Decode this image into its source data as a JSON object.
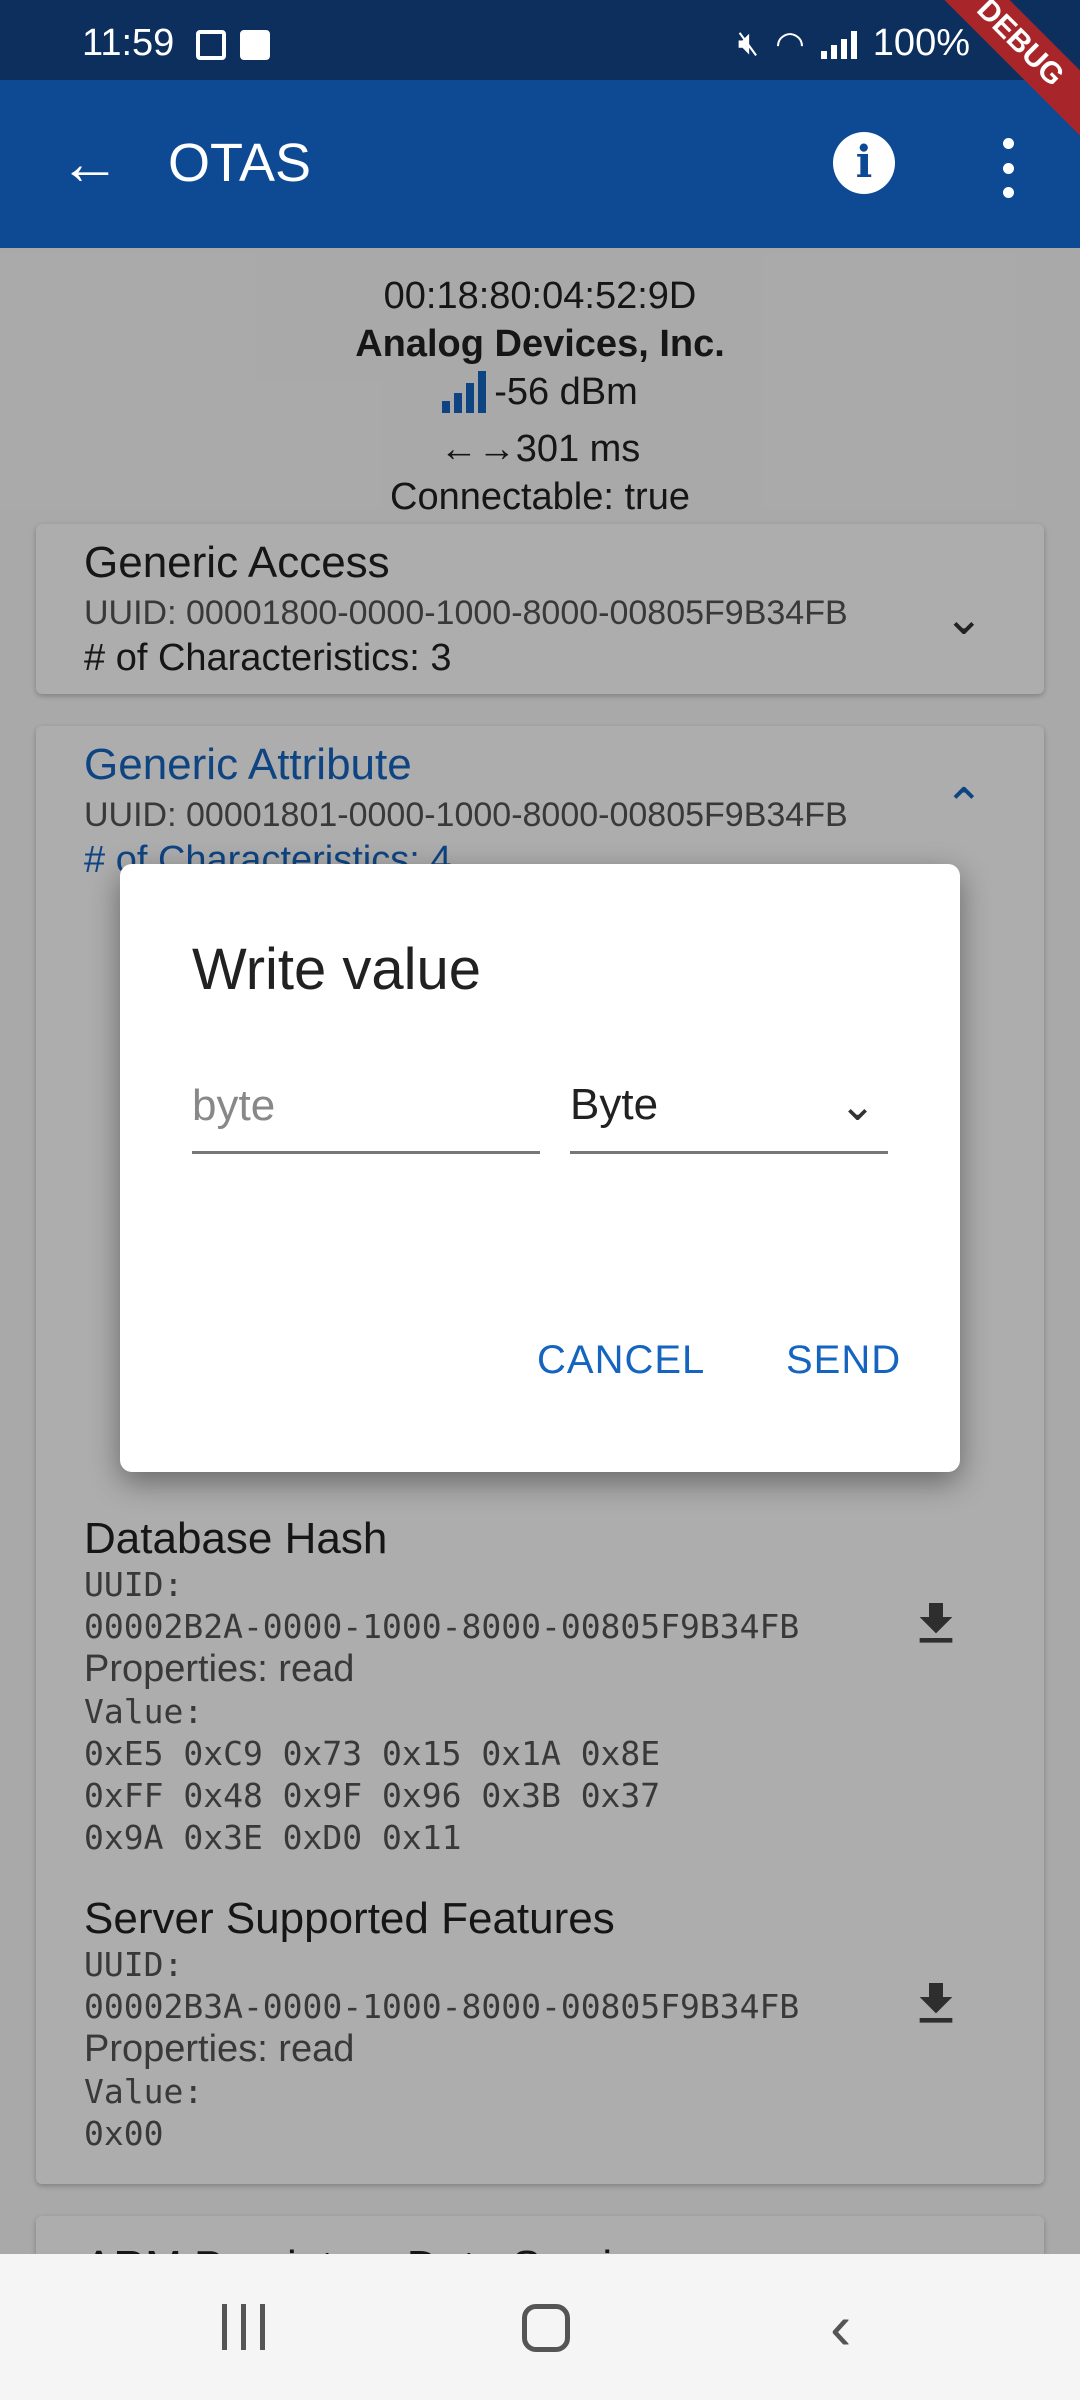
{
  "status_bar": {
    "time": "11:59",
    "battery": "100%",
    "icons": [
      "image-icon",
      "screen-record-icon",
      "mute-icon",
      "wifi-icon",
      "signal-icon",
      "battery-icon"
    ]
  },
  "app_bar": {
    "title": "OTAS",
    "debug_label": "DEBUG",
    "back_icon": "arrow-back-icon",
    "info_icon": "info-icon",
    "more_icon": "more-vert-icon"
  },
  "device": {
    "address": "00:18:80:04:52:9D",
    "manufacturer": "Analog Devices, Inc.",
    "rssi": "-56 dBm",
    "interval": "301 ms",
    "connectable": "Connectable: true"
  },
  "services": [
    {
      "name": "Generic Access",
      "uuid": "UUID: 00001800-0000-1000-8000-00805F9B34FB",
      "count": "# of Characteristics: 3"
    },
    {
      "name": "Generic Attribute",
      "uuid": "UUID: 00001801-0000-1000-8000-00805F9B34FB",
      "count": "# of Characteristics: 4"
    }
  ],
  "characteristics": [
    {
      "name": "Database Hash",
      "uuid_label": "UUID:",
      "uuid": "00002B2A-0000-1000-8000-00805F9B34FB",
      "properties": "Properties: read",
      "value_label": "Value:",
      "value_lines": [
        "0xE5 0xC9 0x73 0x15 0x1A 0x8E",
        "0xFF 0x48 0x9F 0x96 0x3B 0x37",
        "0x9A 0x3E 0xD0 0x11"
      ]
    },
    {
      "name": "Server Supported Features",
      "uuid_label": "UUID:",
      "uuid": "00002B3A-0000-1000-8000-00805F9B34FB",
      "properties": "Properties: read",
      "value_label": "Value:",
      "value_lines": [
        "0x00"
      ]
    }
  ],
  "next_service": "ARM Propietary Data Service",
  "dialog": {
    "title": "Write value",
    "input_placeholder": "byte",
    "input_value": "",
    "type_selected": "Byte",
    "cancel_label": "CANCEL",
    "send_label": "SEND"
  },
  "colors": {
    "status_bar": "#0c2f5e",
    "app_bar": "#0d4a93",
    "accent": "#1565c0",
    "debug_banner": "#a8262a"
  }
}
